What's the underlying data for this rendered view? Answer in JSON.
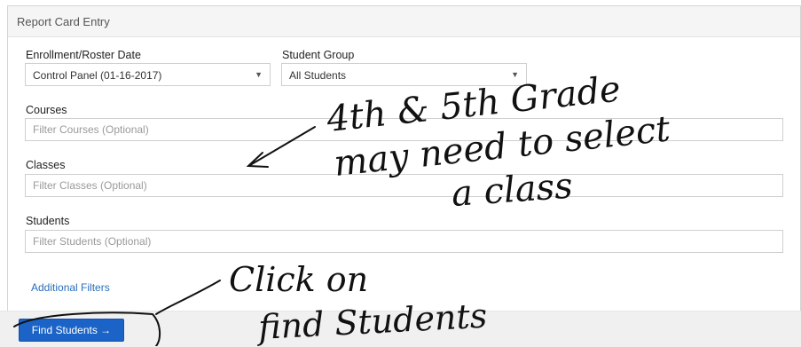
{
  "panel": {
    "title": "Report Card Entry"
  },
  "enrollment": {
    "label": "Enrollment/Roster Date",
    "value": "Control Panel (01-16-2017)"
  },
  "student_group": {
    "label": "Student Group",
    "value": "All Students"
  },
  "courses": {
    "label": "Courses",
    "placeholder": "Filter Courses (Optional)"
  },
  "classes": {
    "label": "Classes",
    "placeholder": "Filter Classes (Optional)"
  },
  "students": {
    "label": "Students",
    "placeholder": "Filter Students (Optional)"
  },
  "additional_filters": "Additional Filters",
  "find_button": "Find Students →",
  "handwriting": {
    "line1": "4th & 5th Grade",
    "line2": "may need to select",
    "line3": "a class",
    "line4": "Click on",
    "line5": "find Students"
  },
  "colors": {
    "button": "#1b63c6",
    "link": "#2a6ebb",
    "ink": "#111111"
  }
}
